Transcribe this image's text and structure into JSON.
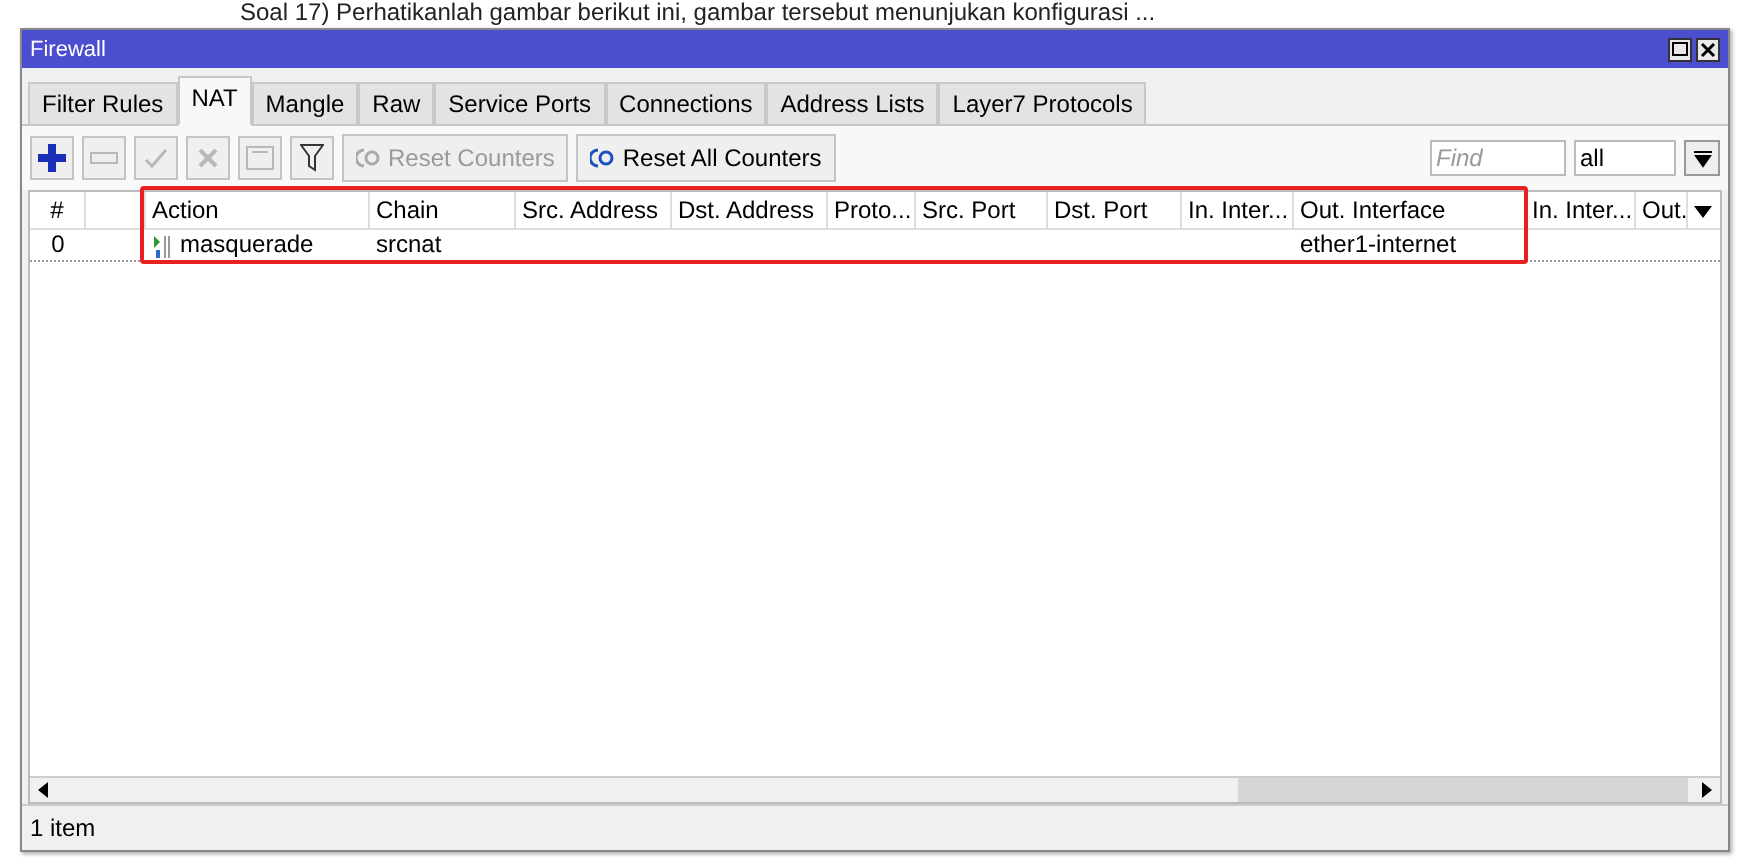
{
  "question_text": "Soal 17) Perhatikanlah gambar berikut ini, gambar tersebut menunjukan konfigurasi ...",
  "window": {
    "title": "Firewall"
  },
  "tabs": [
    {
      "label": "Filter Rules",
      "selected": false
    },
    {
      "label": "NAT",
      "selected": true
    },
    {
      "label": "Mangle",
      "selected": false
    },
    {
      "label": "Raw",
      "selected": false
    },
    {
      "label": "Service Ports",
      "selected": false
    },
    {
      "label": "Connections",
      "selected": false
    },
    {
      "label": "Address Lists",
      "selected": false
    },
    {
      "label": "Layer7 Protocols",
      "selected": false
    }
  ],
  "toolbar": [
    {
      "kind": "add",
      "disabled": false
    },
    {
      "kind": "remove",
      "disabled": true
    },
    {
      "kind": "enable",
      "disabled": true
    },
    {
      "kind": "disable",
      "disabled": true
    },
    {
      "kind": "comment",
      "disabled": true
    },
    {
      "kind": "filter",
      "disabled": false
    },
    {
      "kind": "reset",
      "label": "Reset Counters",
      "disabled": true
    },
    {
      "kind": "reset",
      "label": "Reset All Counters",
      "disabled": false
    }
  ],
  "find": {
    "placeholder": "Find"
  },
  "filter_select": {
    "value": "all"
  },
  "table": {
    "highlight": {
      "visible": true
    },
    "columns": [
      {
        "kind": "text",
        "label": "#"
      },
      {
        "kind": "blank"
      },
      {
        "kind": "text",
        "label": "Action"
      },
      {
        "kind": "text",
        "label": "Chain"
      },
      {
        "kind": "text",
        "label": "Src. Address"
      },
      {
        "kind": "text",
        "label": "Dst. Address"
      },
      {
        "kind": "text",
        "label": "Proto..."
      },
      {
        "kind": "text",
        "label": "Src. Port"
      },
      {
        "kind": "text",
        "label": "Dst. Port"
      },
      {
        "kind": "text",
        "label": "In. Inter..."
      },
      {
        "kind": "text",
        "label": "Out. Interface"
      },
      {
        "kind": "text",
        "label": "In. Inter..."
      },
      {
        "kind": "text",
        "label": "Out."
      }
    ],
    "rows": [
      {
        "cells": [
          "0",
          "",
          "masquerade",
          "srcnat",
          "",
          "",
          "",
          "",
          "",
          "",
          "ether1-internet",
          "",
          ""
        ]
      }
    ]
  },
  "status_bar": "1 item"
}
